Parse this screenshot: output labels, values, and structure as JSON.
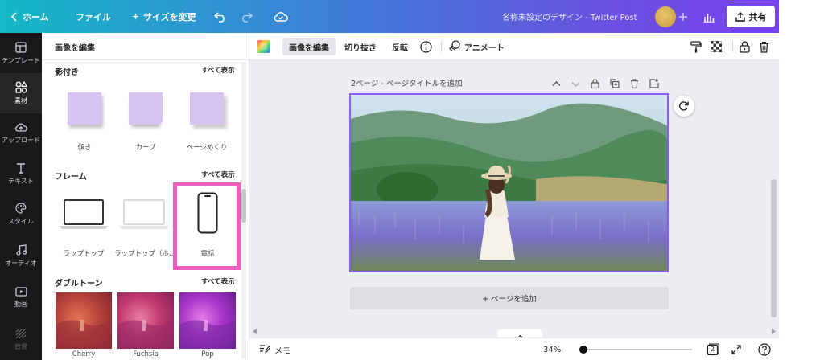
{
  "topbar": {
    "home": "ホーム",
    "file": "ファイル",
    "resize": "サイズを変更",
    "doc_title": "名称未設定のデザイン - Twitter Post",
    "share": "共有"
  },
  "rail": {
    "items": [
      {
        "label": "テンプレート",
        "icon": "template-icon"
      },
      {
        "label": "素材",
        "icon": "elements-icon"
      },
      {
        "label": "アップロード",
        "icon": "upload-icon"
      },
      {
        "label": "テキスト",
        "icon": "text-icon"
      },
      {
        "label": "スタイル",
        "icon": "palette-icon"
      },
      {
        "label": "オーディオ",
        "icon": "audio-icon"
      },
      {
        "label": "動画",
        "icon": "video-icon"
      },
      {
        "label": "背景",
        "icon": "background-icon"
      }
    ]
  },
  "panel": {
    "header": "画像を編集",
    "see_all": "すべて表示",
    "shadows": {
      "title": "影付き",
      "items": [
        "傾き",
        "カーブ",
        "ページめくり"
      ]
    },
    "frames": {
      "title": "フレーム",
      "items": [
        "ラップトップ",
        "ラップトップ（ホ…",
        "電話"
      ]
    },
    "duotone": {
      "title": "ダブルトーン",
      "items": [
        "Cherry",
        "Fuchsia",
        "Pop"
      ]
    }
  },
  "toolbar": {
    "edit_image": "画像を編集",
    "crop": "切り抜き",
    "flip": "反転",
    "animate": "アニメート"
  },
  "canvas": {
    "page_label": "2ページ - ページタイトルを追加",
    "add_page": "+ ページを追加"
  },
  "bottom": {
    "notes": "メモ",
    "zoom": "34%",
    "zoom_fraction": 0.34,
    "page_count": "2"
  },
  "colors": {
    "accent_purple": "#8b5cf6",
    "highlight_pink": "#f05ebf",
    "rail_bg": "#18191b",
    "shadow_note": "#d6c3f2"
  }
}
